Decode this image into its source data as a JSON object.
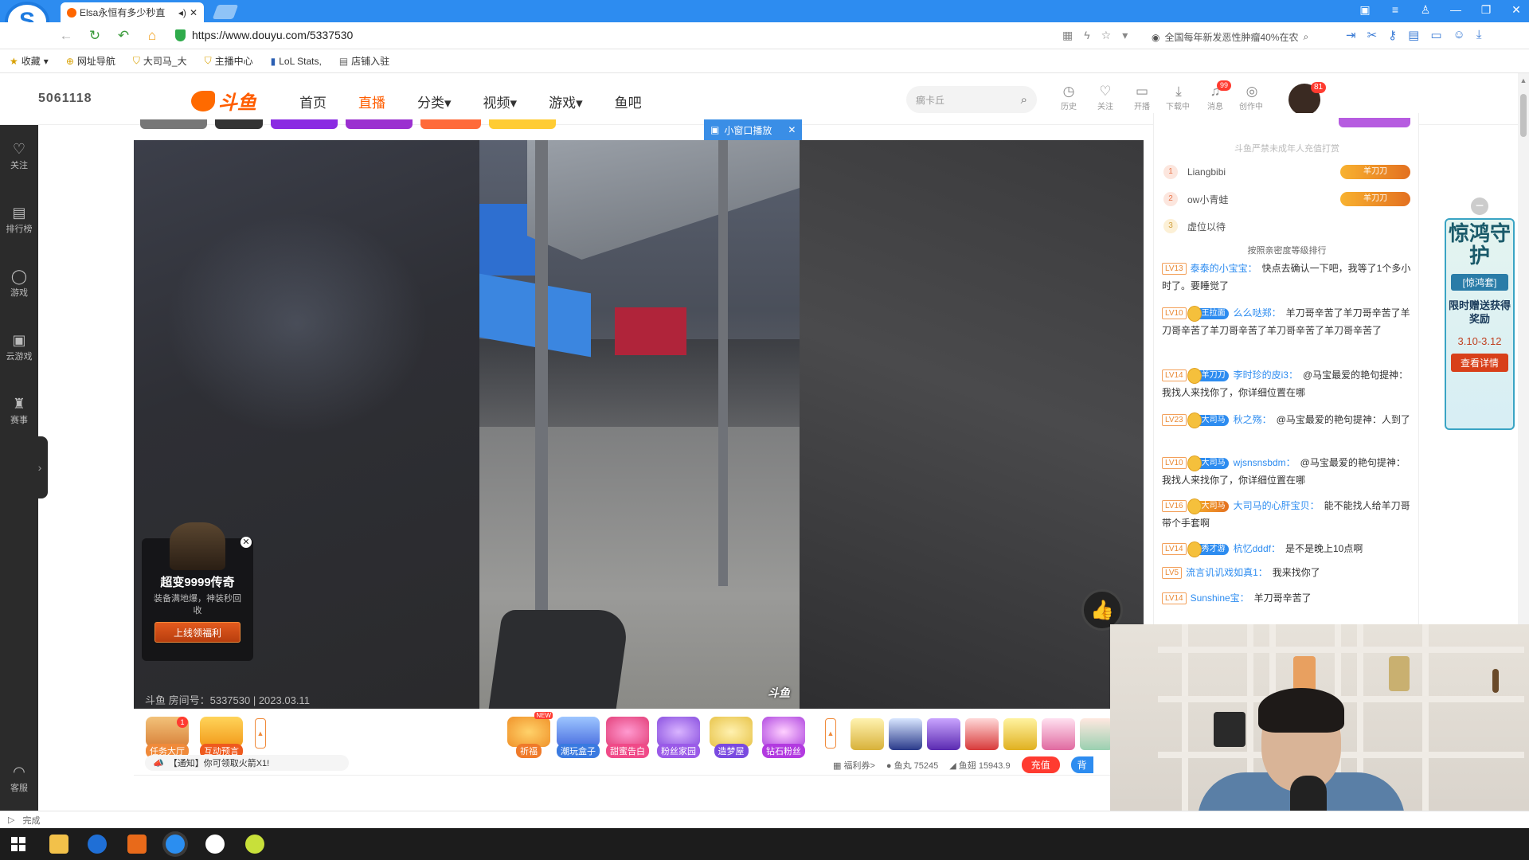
{
  "browser": {
    "tab_title": "Elsa永恒有多少秒直",
    "url": "https://www.douyu.com/5337530",
    "news_ticker": "全国每年新发恶性肿瘤40%在农",
    "status_text": "完成",
    "logo_letter": "S"
  },
  "bookmarks": [
    {
      "label": "收藏"
    },
    {
      "label": "网址导航"
    },
    {
      "label": "大司马_大"
    },
    {
      "label": "主播中心"
    },
    {
      "label": "LoL Stats,"
    },
    {
      "label": "店铺入驻"
    }
  ],
  "header": {
    "mark": "5061118",
    "logo_text": "斗鱼",
    "nav": [
      {
        "label": "首页"
      },
      {
        "label": "直播"
      },
      {
        "label": "分类▾"
      },
      {
        "label": "视频▾"
      },
      {
        "label": "游戏▾"
      },
      {
        "label": "鱼吧"
      }
    ],
    "search_placeholder": "瘸卡丘",
    "icons": [
      {
        "label": "历史",
        "icon": "clock-icon",
        "glyph": "◷"
      },
      {
        "label": "关注",
        "icon": "heart-icon",
        "glyph": "♡"
      },
      {
        "label": "开播",
        "icon": "camera-icon",
        "glyph": "▭"
      },
      {
        "label": "下载中心",
        "icon": "download-icon",
        "glyph": "⤓"
      },
      {
        "label": "消息",
        "icon": "bell-icon",
        "glyph": "♫",
        "badge": "99"
      },
      {
        "label": "创作中心",
        "icon": "bulb-icon",
        "glyph": "◎"
      }
    ],
    "avatar_badge": "81"
  },
  "left_rail": [
    {
      "label": "关注",
      "icon": "heart-icon",
      "glyph": "♡"
    },
    {
      "label": "排行榜",
      "icon": "ranking-icon",
      "glyph": "▤"
    },
    {
      "label": "游戏",
      "icon": "game-icon",
      "glyph": "◯"
    },
    {
      "label": "云游戏",
      "icon": "gamepad-icon",
      "glyph": "▣"
    },
    {
      "label": "赛事",
      "icon": "trophy-icon",
      "glyph": "♜"
    },
    {
      "label": "客服",
      "icon": "headset-icon",
      "glyph": "◠"
    }
  ],
  "player": {
    "mini_player": "小窗口播放",
    "watermark": "斗鱼",
    "room_info": "斗鱼 房间号：5337530 | 2023.03.11"
  },
  "ad": {
    "title": "超变9999传奇",
    "desc": "装备满地爆，神装秒回收",
    "button": "上线领福利"
  },
  "tools_left": [
    {
      "label": "任务大厅",
      "badge": "1"
    },
    {
      "label": "互动预言"
    }
  ],
  "tools_mid": [
    {
      "label": "祈福",
      "tag": "NEW"
    },
    {
      "label": "潮玩盒子"
    },
    {
      "label": "甜蜜告白"
    },
    {
      "label": "粉丝家园"
    },
    {
      "label": "造梦屋"
    },
    {
      "label": "钻石粉丝"
    }
  ],
  "notice": "【通知】你可领取火箭X1!",
  "wallet": {
    "welfare": "福利券>",
    "fish_ball": "鱼丸 75245",
    "fish_fin": "鱼翅 15943.9",
    "recharge": "充值",
    "blue_btn": "背"
  },
  "chat": {
    "notice": "斗鱼严禁未成年人充值打赏",
    "ranking": [
      {
        "rank": "1",
        "name": "Liangbibi",
        "badge": "羊刀刀"
      },
      {
        "rank": "2",
        "name": "ow小青蛙",
        "badge": "羊刀刀"
      },
      {
        "rank": "3",
        "name": "虚位以待",
        "badge": ""
      }
    ],
    "rank_sort": "按照亲密度等级排行",
    "messages": [
      {
        "lv": "LV13",
        "fan": "",
        "nick": "泰泰的小宝宝：",
        "text": "快点去确认一下吧，我等了1个多小时了。要睡觉了"
      },
      {
        "lv": "LV10",
        "fan": "王拉面",
        "nick": "么么哒郑：",
        "text": "羊刀哥辛苦了羊刀哥辛苦了羊刀哥辛苦了羊刀哥辛苦了羊刀哥辛苦了羊刀哥辛苦了"
      },
      {
        "lv": "LV14",
        "fan": "羊刀刀",
        "nick": "李时珍的皮i3：",
        "text": "@马宝最爱的艳句提神：我找人来找你了，你详细位置在哪"
      },
      {
        "lv": "LV23",
        "fan": "大司马",
        "nick": "秋之殇：",
        "text": "@马宝最爱的艳句提神：人到了"
      },
      {
        "lv": "LV10",
        "fan": "大司马",
        "nick": "wjsnsnsbdm：",
        "text": "@马宝最爱的艳句提神：我找人来找你了，你详细位置在哪"
      },
      {
        "lv": "LV16",
        "fan": "大司马",
        "nick": "大司马的心肝宝贝：",
        "text": "能不能找人给羊刀哥带个手套啊"
      },
      {
        "lv": "LV14",
        "fan": "秀才游",
        "nick": "杭忆dddf：",
        "text": "是不是晚上10点啊"
      },
      {
        "lv": "LV5",
        "fan": "",
        "nick": "流言讥讥戏如真1：",
        "text": "我来找你了"
      },
      {
        "lv": "LV14",
        "fan": "",
        "nick": "Sunshine宝：",
        "text": "羊刀哥辛苦了"
      }
    ]
  },
  "promo": {
    "title": "惊鸿守护",
    "tag": "[惊鸿套]",
    "text": "限时赠送获得奖励",
    "date": "3.10-3.12",
    "button": "查看详情"
  }
}
